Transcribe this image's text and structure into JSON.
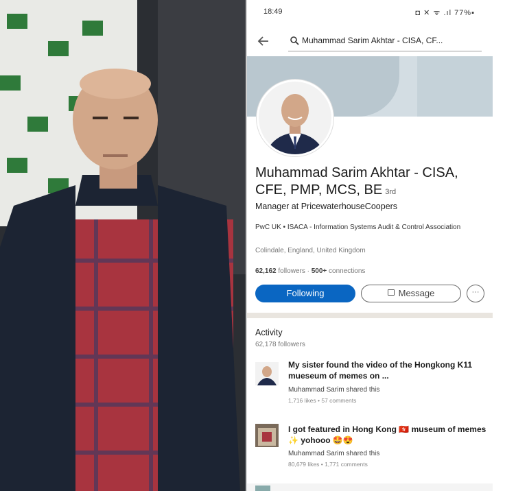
{
  "status_bar": {
    "time": "18:49",
    "icons": "◘ ✕ ᯤ .ıl 77%▪"
  },
  "search": {
    "query": "Muhammad Sarim Akhtar - CISA, CF..."
  },
  "profile": {
    "name": "Muhammad Sarim Akhtar - CISA, CFE, PMP, MCS, BE",
    "degree": "3rd",
    "headline": "Manager at PricewaterhouseCoopers",
    "affiliations": "PwC UK • ISACA - Information Systems Audit & Control Association",
    "location": "Colindale, England, United Kingdom",
    "followers": "62,162",
    "followers_label": "followers",
    "separator": " · ",
    "connections": "500+",
    "connections_label": "connections"
  },
  "actions": {
    "following": "Following",
    "message": "Message",
    "more": "···"
  },
  "activity": {
    "title": "Activity",
    "followers": "62,178 followers",
    "posts": [
      {
        "title": "My sister found the video of the Hongkong K11 mueseum of memes on ...",
        "by": "Muhammad Sarim shared this",
        "meta": "1,716 likes • 57 comments"
      },
      {
        "title": "I got featured in Hong Kong 🇭🇰 museum of memes ✨ yohooo 🤩😍",
        "by": "Muhammad Sarim shared this",
        "meta": "80,679 likes • 1,771 comments"
      }
    ]
  },
  "colors": {
    "accent": "#0a66c2",
    "divider": "#e9e5df",
    "vest": "#1c2433",
    "shirt_red": "#b3323d"
  },
  "icons": [
    "back-arrow-icon",
    "search-icon",
    "lock-icon",
    "more-icon"
  ]
}
